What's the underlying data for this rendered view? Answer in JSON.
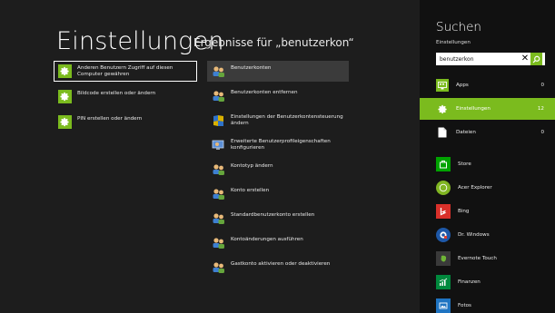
{
  "header": {
    "title": "Einstellungen",
    "subtitle": "Ergebnisse für „benutzerkon“"
  },
  "results_col1": [
    {
      "label": "Anderen Benutzern Zugriff auf diesen Computer gewähren",
      "icon": "gear-icon"
    },
    {
      "label": "Bildcode erstellen oder ändern",
      "icon": "gear-icon"
    },
    {
      "label": "PIN erstellen oder ändern",
      "icon": "gear-icon"
    }
  ],
  "results_col2": [
    {
      "label": "Benutzerkonten",
      "icon": "users-icon"
    },
    {
      "label": "Benutzerkonten entfernen",
      "icon": "users-icon"
    },
    {
      "label": "Einstellungen der Benutzerkontensteuerung ändern",
      "icon": "uac-flag-icon"
    },
    {
      "label": "Erweiterte Benutzerprofileigenschaften konfigurieren",
      "icon": "system-properties-icon"
    },
    {
      "label": "Kontotyp ändern",
      "icon": "users-icon"
    },
    {
      "label": "Konto erstellen",
      "icon": "users-icon"
    },
    {
      "label": "Standardbenutzerkonto erstellen",
      "icon": "users-icon"
    },
    {
      "label": "Kontoänderungen ausführen",
      "icon": "users-icon"
    },
    {
      "label": "Gastkonto aktivieren oder deaktivieren",
      "icon": "users-icon"
    }
  ],
  "pane": {
    "title": "Suchen",
    "scope_label": "Einstellungen",
    "search_value": "benutzerkon",
    "scopes": [
      {
        "label": "Apps",
        "count": "0",
        "icon": "apps-icon"
      },
      {
        "label": "Einstellungen",
        "count": "12",
        "icon": "gear-icon"
      },
      {
        "label": "Dateien",
        "count": "0",
        "icon": "document-icon"
      }
    ],
    "apps": [
      {
        "label": "Store",
        "icon": "store-icon",
        "color": "#00a300"
      },
      {
        "label": "Acer Explorer",
        "icon": "acer-explorer-icon",
        "color": "#80b522"
      },
      {
        "label": "Bing",
        "icon": "bing-icon",
        "color": "#d9302a"
      },
      {
        "label": "Dr. Windows",
        "icon": "dr-windows-icon",
        "color": "#1e58a8"
      },
      {
        "label": "Evernote Touch",
        "icon": "evernote-icon",
        "color": "#3a3a3a"
      },
      {
        "label": "Finanzen",
        "icon": "finance-icon",
        "color": "#00893d"
      },
      {
        "label": "Fotos",
        "icon": "photos-icon",
        "color": "#1f74c2"
      }
    ]
  },
  "colors": {
    "accent": "#7bbb1e",
    "background": "#1d1d1d",
    "pane_background": "#111111"
  }
}
